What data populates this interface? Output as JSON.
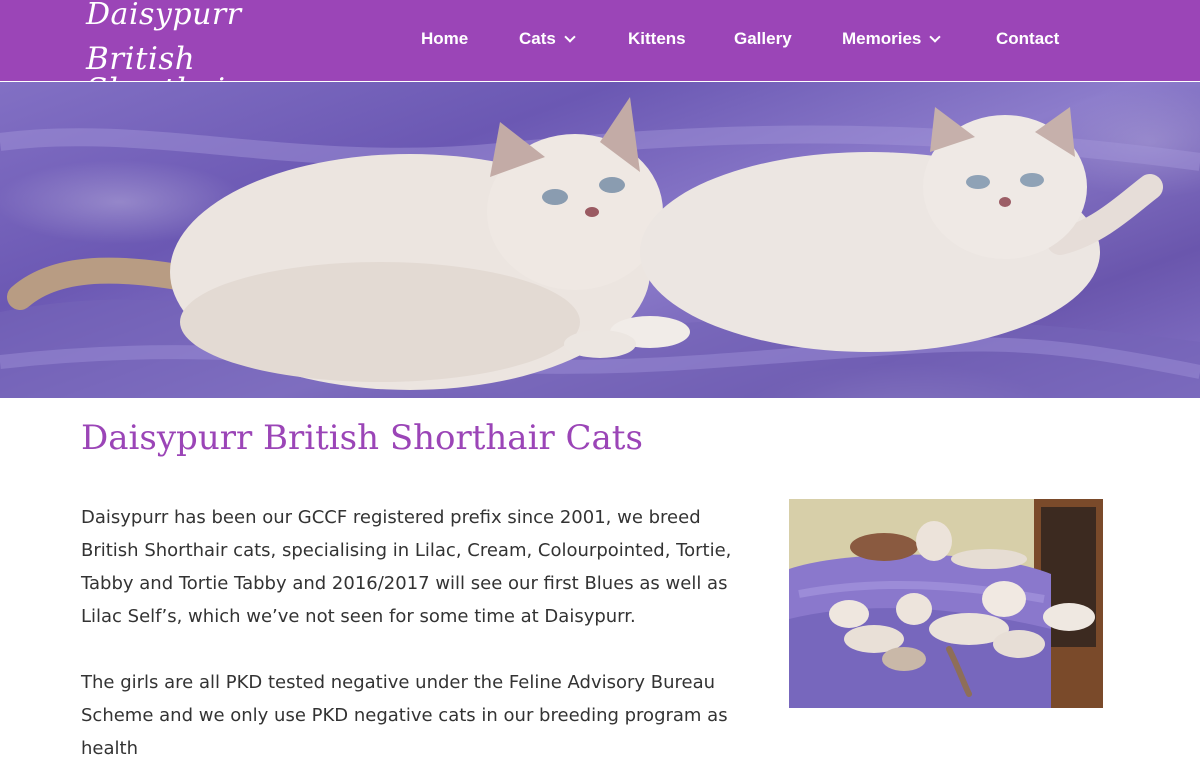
{
  "brand": {
    "line1": "Daisypurr",
    "line2": "British Shorthair"
  },
  "nav": {
    "items": [
      {
        "label": "Home",
        "has_dropdown": false
      },
      {
        "label": "Cats",
        "has_dropdown": true
      },
      {
        "label": "Kittens",
        "has_dropdown": false
      },
      {
        "label": "Gallery",
        "has_dropdown": false
      },
      {
        "label": "Memories",
        "has_dropdown": true
      },
      {
        "label": "Contact",
        "has_dropdown": false
      }
    ]
  },
  "main": {
    "title": "Daisypurr British Shorthair Cats",
    "paragraph1": "Daisypurr has been our GCCF registered prefix since 2001, we breed British Shorthair cats, specialising in Lilac, Cream, Colourpointed, Tortie, Tabby and Tortie Tabby and 2016/2017 will see our first Blues as well as Lilac Self’s, which we’ve not seen for some time at Daisypurr.",
    "paragraph2": "The girls are all PKD tested negative under the Feline Advisory Bureau Scheme and we only use PKD negative cats in our breeding program as health"
  },
  "colors": {
    "header_bg": "#9b45b7",
    "title_color": "#9b45b7",
    "text_color": "#333333"
  }
}
